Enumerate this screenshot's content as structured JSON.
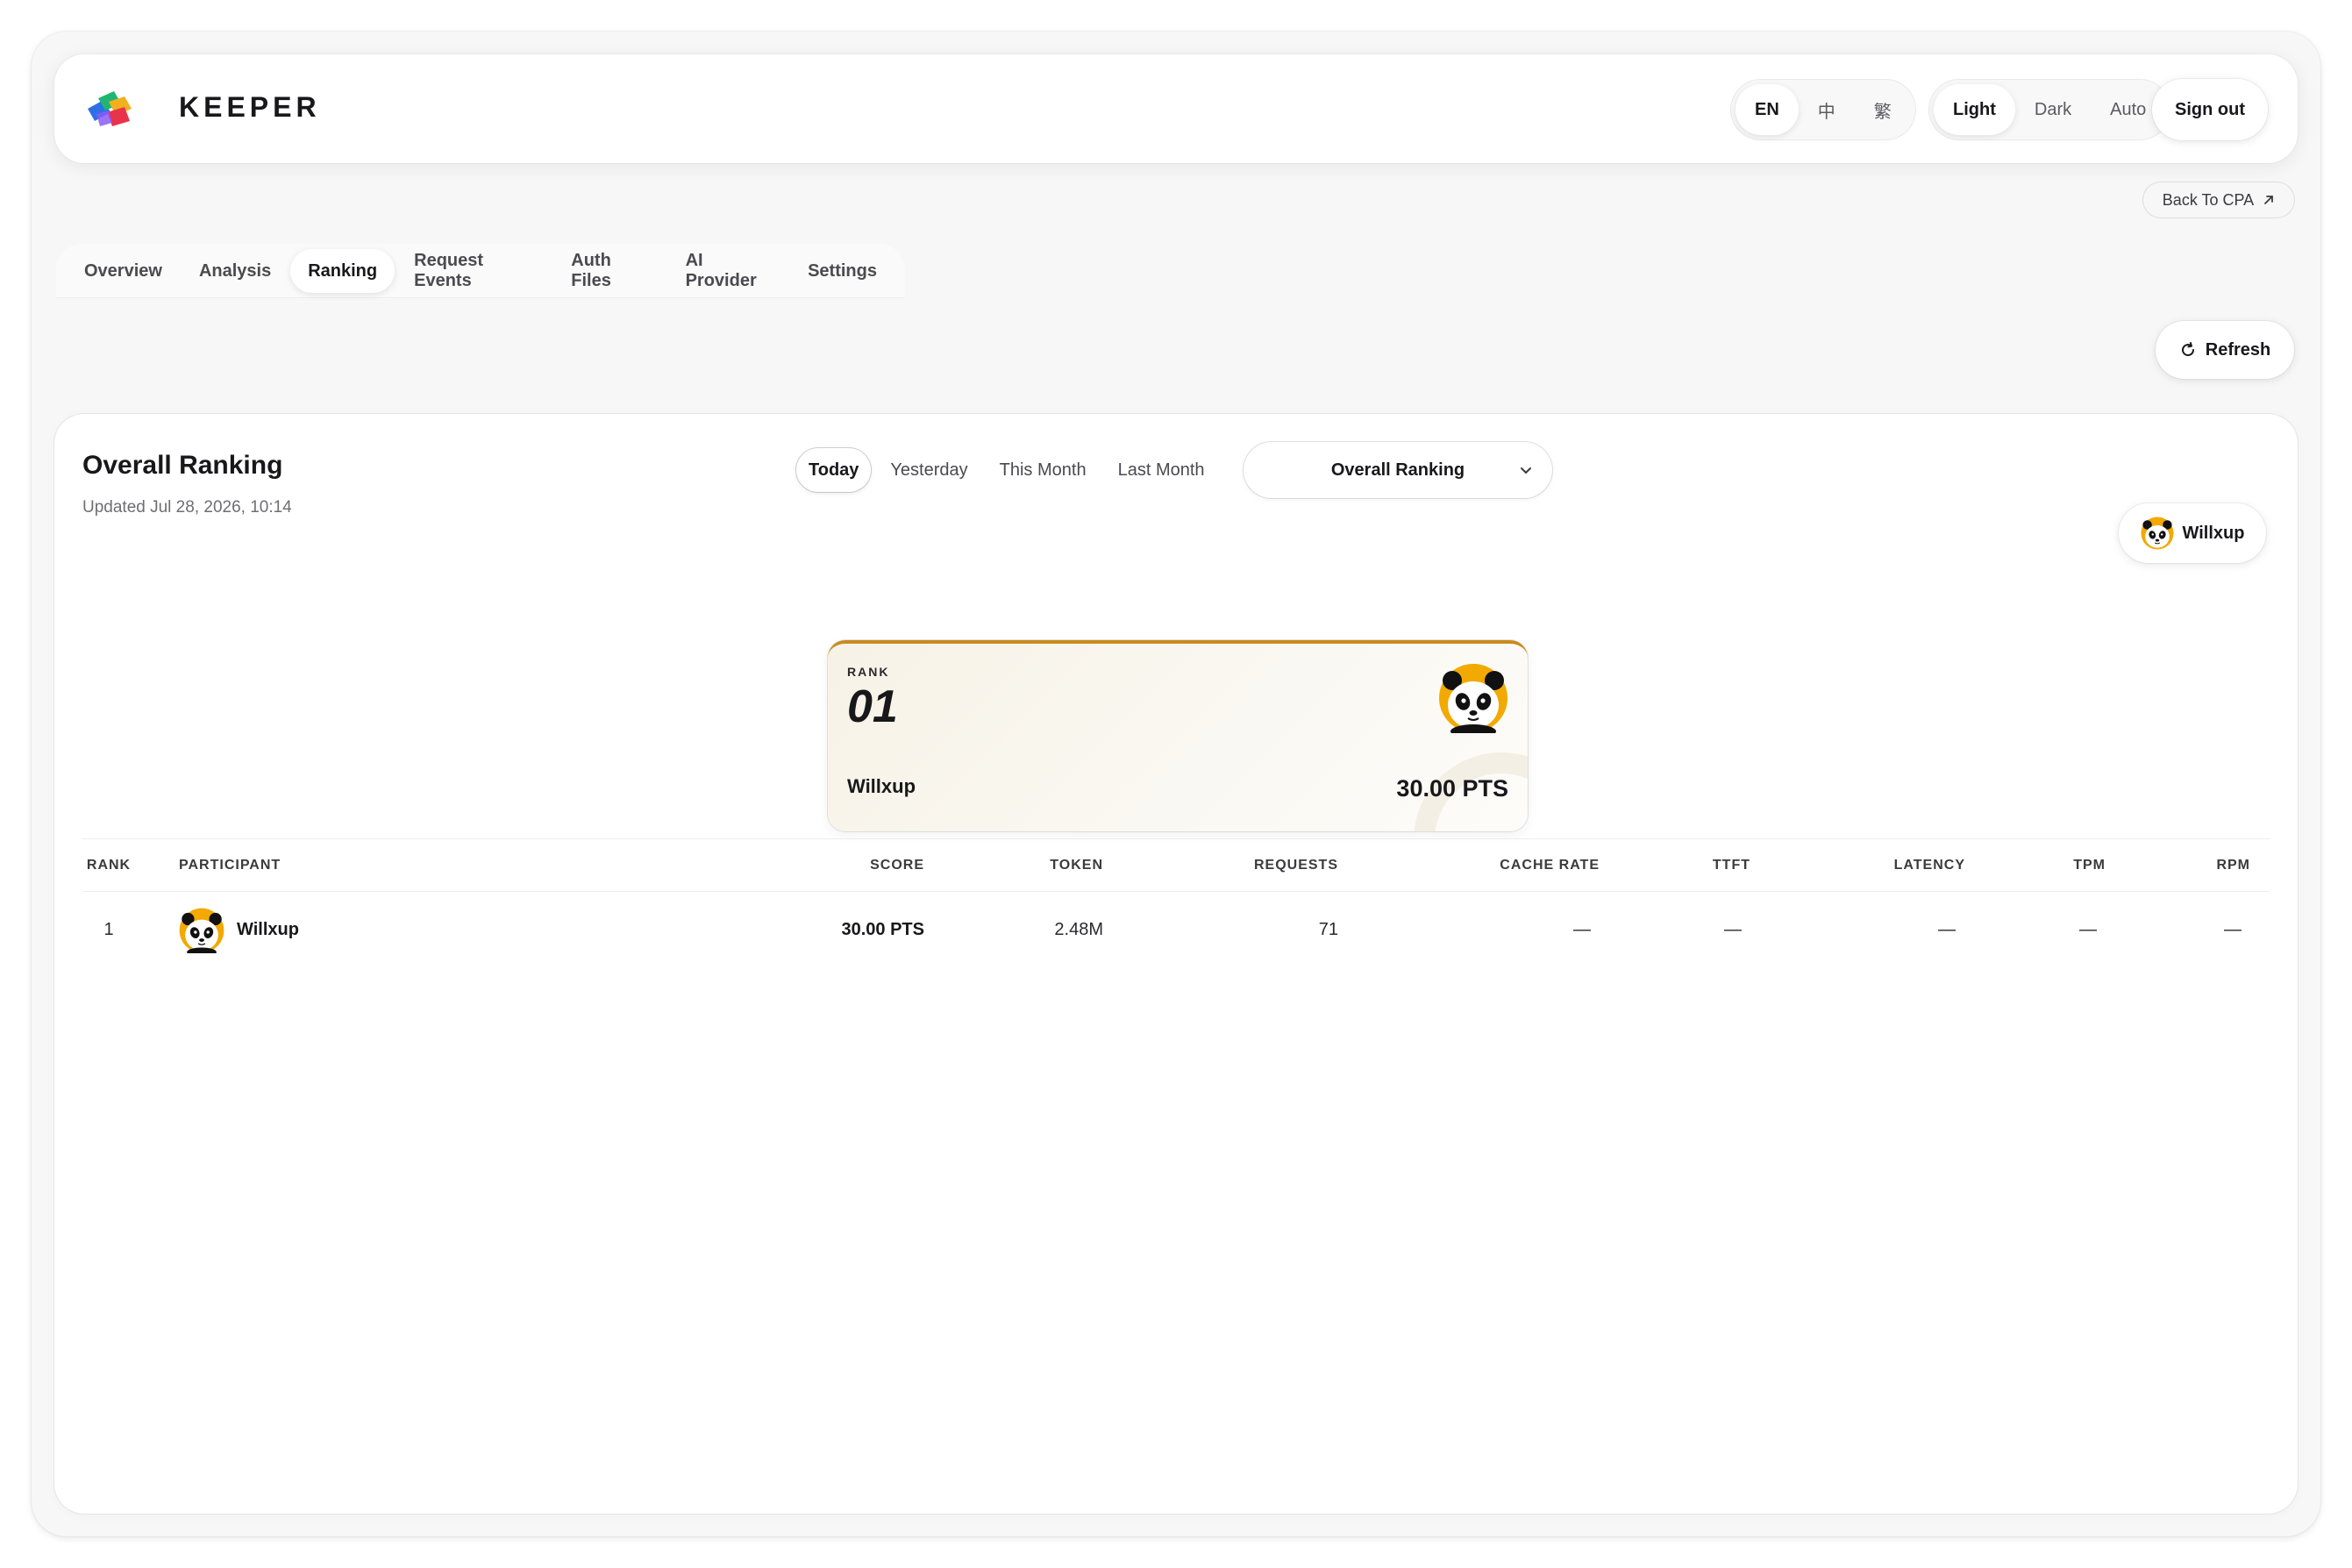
{
  "app": {
    "brand": "KEEPER",
    "languages": [
      "EN",
      "中",
      "繁"
    ],
    "active_language": "EN",
    "themes": [
      "Light",
      "Dark",
      "Auto"
    ],
    "active_theme": "Light",
    "sign_out_label": "Sign out",
    "back_link_label": "Back To CPA"
  },
  "tabs": [
    {
      "label": "Overview"
    },
    {
      "label": "Analysis"
    },
    {
      "label": "Ranking",
      "active": true
    },
    {
      "label": "Request Events"
    },
    {
      "label": "Auth Files"
    },
    {
      "label": "AI Provider"
    },
    {
      "label": "Settings"
    }
  ],
  "toolbar": {
    "refresh_label": "Refresh"
  },
  "ranking": {
    "title": "Overall Ranking",
    "updated": "Updated Jul 28, 2026, 10:14",
    "periods": [
      "Today",
      "Yesterday",
      "This Month",
      "Last Month"
    ],
    "active_period": "Today",
    "board_select_value": "Overall Ranking",
    "current_user": "Willxup",
    "podium": {
      "rank_label": "RANK",
      "rank": "01",
      "name": "Willxup",
      "score": "30.00 PTS"
    },
    "columns": [
      "RANK",
      "PARTICIPANT",
      "SCORE",
      "TOKEN",
      "REQUESTS",
      "CACHE RATE",
      "TTFT",
      "LATENCY",
      "TPM",
      "RPM"
    ],
    "rows": [
      {
        "rank": "1",
        "participant": "Willxup",
        "score": "30.00 PTS",
        "token": "2.48M",
        "requests": "71",
        "cache_rate": "—",
        "ttft": "—",
        "latency": "—",
        "tpm": "—",
        "rpm": "—"
      }
    ]
  },
  "colors": {
    "accent_gold": "#c98a1e",
    "avatar_ring": "#f0a500",
    "text_primary": "#18181b"
  },
  "icons": {
    "logo": "keeper-cubes-logo",
    "external_link": "arrow-up-right-icon",
    "refresh": "refresh-icon",
    "dropdown": "chevron-down-icon",
    "avatar": "panda-avatar-icon"
  }
}
